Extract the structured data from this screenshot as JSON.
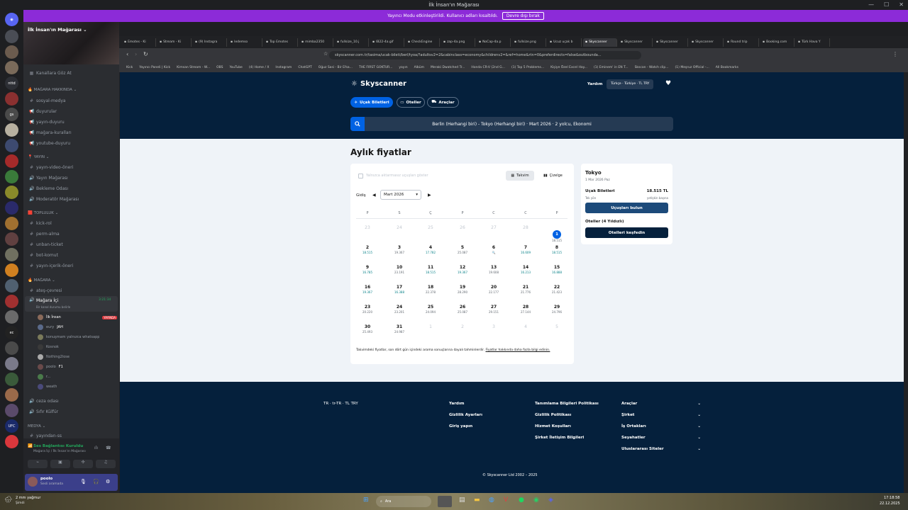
{
  "titlebar": {
    "title": "İlk İnsan'ın Mağarası"
  },
  "notice": {
    "text": "Yayıncı Modu etkinleştirildi. Kullanıcı adları kısaltıldı.",
    "button": "Devre dışı bırak"
  },
  "sidebar": {
    "server_name": "İlk İnsan'ın Mağarası",
    "top_channel": "Kanallara Göz At",
    "categories": [
      {
        "name": "MAĞARA HAKKINDA",
        "channels": [
          "sosyal-medya",
          "duyurular",
          "yayın-duyuru",
          "mağara-kuralları",
          "youtube-duyuru"
        ]
      },
      {
        "name": "YAYIN",
        "channels": [
          "yayın-video-öneri",
          "Yayın Mağarası",
          "Bekleme Odası",
          "Moderatör Mağarası"
        ]
      },
      {
        "name": "TOPLULUK",
        "channels": [
          "kick-rol",
          "perm-alma",
          "unban-ticket",
          "bot-komut",
          "yayın-içerik-öneri"
        ]
      },
      {
        "name": "MAĞARA",
        "channels": [
          "ateş-çevresi"
        ]
      }
    ],
    "voice_channel": {
      "name": "Mağara İçi",
      "time": "3:21:34",
      "subtitle": "Bir kanal durumu belirle"
    },
    "voice_users": [
      {
        "name": "İlk İnsan",
        "badge": "YAYINDA"
      },
      {
        "name": "eury",
        "suffix": "JAH"
      },
      {
        "name": "konuşmam yalnızca whatsapp"
      },
      {
        "name": "Kosnok"
      },
      {
        "name": "Nothing2lose"
      },
      {
        "name": "poolo",
        "suffix": "F1"
      },
      {
        "name": "r..."
      },
      {
        "name": "weath"
      }
    ],
    "after_channels": [
      "ceza odası",
      "Sıfır Külfür"
    ],
    "media_category": "Medya",
    "media_channel": "yayından-ss",
    "voice_status": {
      "title": "Ses Bağlantısı Kuruldu",
      "subtitle": "Mağara İçi / İlk İnsan'ın Mağarası"
    },
    "user": {
      "name": "poolo",
      "status": "Sesli aramada"
    }
  },
  "browser": {
    "tabs": [
      "Emotes - Ki",
      "Stream - Ki",
      "(9) Instagra",
      "ledemso",
      "Top Emotes",
      "mimba2350",
      "fullsize_10.j",
      "IB22-4a.gif",
      "CheckEngine",
      "zap-4a.png",
      "NoCap-4a.p",
      "fullsize.png",
      "Ucuz uçak b",
      "Skyscanner",
      "Skyscanner",
      "Skyscanner",
      "Skyscanner",
      "Round trip",
      "Booking.com",
      "Türk Hava Y"
    ],
    "url": "skyscanner.com.tr/tasima/ucak-bileti/berl/tyoa/?adultsv2=2&cabinclass=economy&childrenv2=&ref=home&rtn=0&preferdirects=false&outbounda...",
    "bookmarks": [
      "Kick",
      "Yayıncı Paneli | Kick",
      "Kimsan Stream - W...",
      "OBS",
      "YouTube",
      "(4) Home / X",
      "Instagram",
      "ChatGPT",
      "Oğuz Sasi - Bir Efsa...",
      "THE FIRST GOKTUR...",
      "yayın",
      "Albüm",
      "Meraki Dwatched Tr...",
      "Honda CR-V (2nd G...",
      "(1) Top 5 Problems...",
      "Kişiye Özel Excel Hay...",
      "(1) Eminem' in EN T...",
      "Skscan - Watch clip...",
      "(1) Meşruz Official -...",
      "All Bookmarks"
    ]
  },
  "skyscanner": {
    "brand": "Skyscanner",
    "header_links": {
      "help": "Yardım",
      "locale": "Türkçe · Türkiye · TL TRY"
    },
    "nav": [
      "Uçak Biletleri",
      "Oteller",
      "Araçlar"
    ],
    "search_summary": "Berlin (Herhangi biri) - Tokyo (Herhangi biri)  ·  Mart 2026  ·  2 yolcu, Ekonomi",
    "title": "Aylık fiyatlar",
    "direct_only": "Yalnızca aktarmasız uçuşları göster",
    "view_calendar": "Takvim",
    "view_chart": "Çizelge",
    "depart_label": "Gidiş",
    "month_value": "Mart 2026",
    "weekdays": [
      "P",
      "S",
      "Ç",
      "P",
      "C",
      "C",
      "P"
    ],
    "calendar": [
      [
        {
          "d": "23",
          "m": true
        },
        {
          "d": "24",
          "m": true
        },
        {
          "d": "25",
          "m": true
        },
        {
          "d": "26",
          "m": true
        },
        {
          "d": "27",
          "m": true
        },
        {
          "d": "28",
          "m": true
        },
        {
          "d": "1",
          "p": "18.515",
          "s": true
        }
      ],
      [
        {
          "d": "2",
          "p": "18.515",
          "c": true
        },
        {
          "d": "3",
          "p": "19.367"
        },
        {
          "d": "4",
          "p": "17.782",
          "c": true
        },
        {
          "d": "5",
          "p": "25.087"
        },
        {
          "d": "6",
          "p": "🔍"
        },
        {
          "d": "7",
          "p": "16.609",
          "c": true
        },
        {
          "d": "8",
          "p": "18.515",
          "c": true
        }
      ],
      [
        {
          "d": "9",
          "p": "16.785",
          "c": true
        },
        {
          "d": "10",
          "p": "23.191"
        },
        {
          "d": "11",
          "p": "18.515",
          "c": true
        },
        {
          "d": "12",
          "p": "19.367",
          "c": true
        },
        {
          "d": "13",
          "p": "19.608"
        },
        {
          "d": "14",
          "p": "16.213",
          "c": true
        },
        {
          "d": "15",
          "p": "16.888",
          "c": true
        }
      ],
      [
        {
          "d": "16",
          "p": "19.367",
          "c": true
        },
        {
          "d": "17",
          "p": "16.388",
          "c": true
        },
        {
          "d": "18",
          "p": "22.378"
        },
        {
          "d": "19",
          "p": "28.290"
        },
        {
          "d": "20",
          "p": "22.177"
        },
        {
          "d": "21",
          "p": "21.776"
        },
        {
          "d": "22",
          "p": "21.423"
        }
      ],
      [
        {
          "d": "23",
          "p": "20.220"
        },
        {
          "d": "24",
          "p": "23.201"
        },
        {
          "d": "25",
          "p": "24.094"
        },
        {
          "d": "26",
          "p": "25.087"
        },
        {
          "d": "27",
          "p": "29.151"
        },
        {
          "d": "28",
          "p": "27.144"
        },
        {
          "d": "29",
          "p": "24.796"
        }
      ],
      [
        {
          "d": "30",
          "p": "25.493"
        },
        {
          "d": "31",
          "p": "24.987"
        },
        {
          "d": "1",
          "m": true
        },
        {
          "d": "2",
          "m": true
        },
        {
          "d": "3",
          "m": true
        },
        {
          "d": "4",
          "m": true
        },
        {
          "d": "5",
          "m": true
        }
      ]
    ],
    "disclaimer": "Takvimdeki fiyatlar, son dört gün içindeki arama sonuçlarına dayalı tahminlerdir.",
    "disclaimer_link": "Fiyatlar hakkında daha fazla bilgi edinin.",
    "side": {
      "city": "Tokyo",
      "date": "1 Mar 2026 Paz",
      "flights_label": "Uçak Biletleri",
      "price": "18.515 TL",
      "oneway": "Tek yön",
      "per_adult": "yetişkin başına",
      "find_flights": "Uçuşları bulun",
      "hotels_label": "Oteller (4 Yıldızlı)",
      "explore_hotels": "Otelleri keşfedin"
    },
    "footer": {
      "locale": "TR · tr-TR · TL TRY",
      "col1": [
        "Yardım",
        "Gizlilik Ayarları",
        "Giriş yapın"
      ],
      "col2": [
        "Tanımlama Bilgileri Politikası",
        "Gizlilik Politikası",
        "Hizmet Koşulları",
        "Şirket İletişim Bilgileri"
      ],
      "col3": [
        "Araçlar",
        "Şirket",
        "İş Ortakları",
        "Seyahatler",
        "Uluslararası Siteler"
      ],
      "copyright": "© Skyscanner Ltd 2002 – 2025"
    }
  },
  "taskbar": {
    "weather_title": "2 mm yağmur",
    "weather_sub": "Şimdi",
    "search": "Ara",
    "time": "17:18:58",
    "date": "22.12.2025"
  },
  "colors": {
    "sky_dark": "#05203c",
    "sky_blue": "#0062e3",
    "discord_purple": "#8c2bd8",
    "live_red": "#da373c"
  }
}
